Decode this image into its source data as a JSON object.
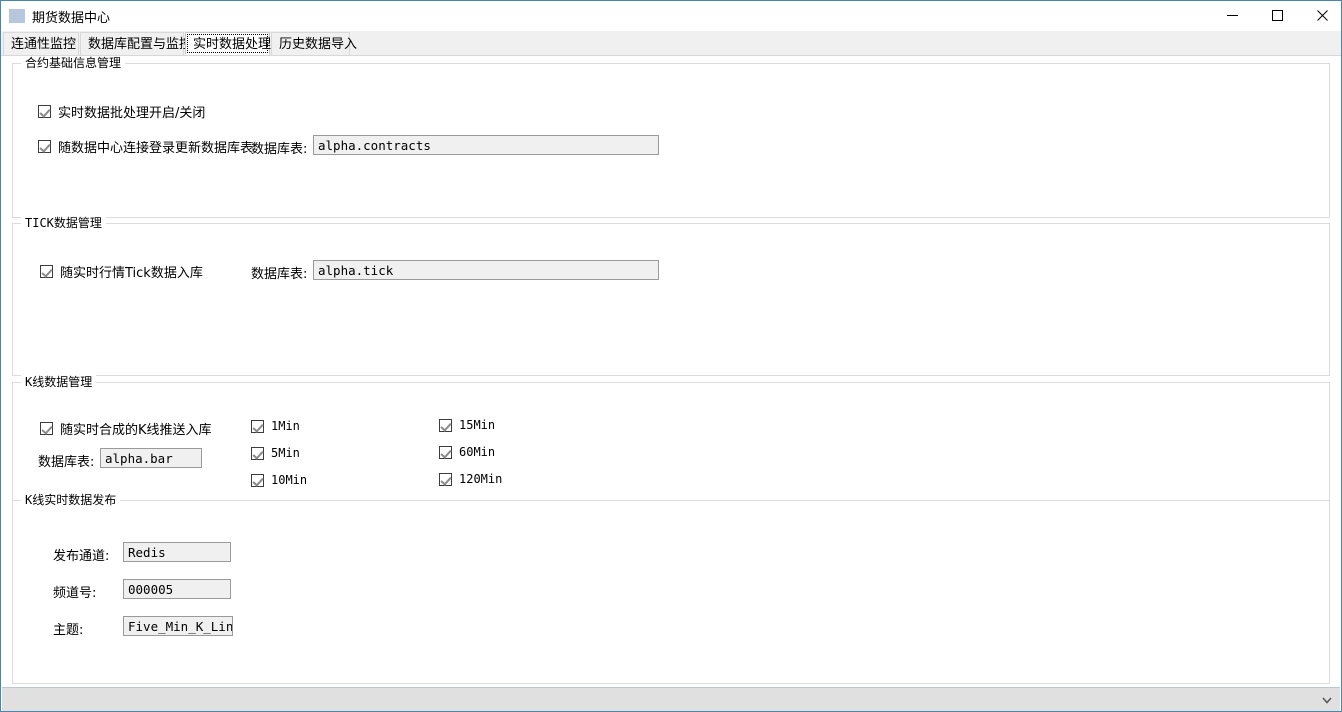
{
  "window": {
    "title": "期货数据中心",
    "icon": "app-icon",
    "controls": {
      "minimize": "minimize-icon",
      "maximize": "maximize-icon",
      "close": "close-icon"
    }
  },
  "tabs": [
    {
      "label": "连通性监控",
      "active": false
    },
    {
      "label": "数据库配置与监控",
      "active": false
    },
    {
      "label": "实时数据处理",
      "active": true
    },
    {
      "label": "历史数据导入",
      "active": false
    }
  ],
  "groups": {
    "contract": {
      "title": "合约基础信息管理",
      "checkboxes": [
        {
          "label": "实时数据批处理开启/关闭",
          "checked": true
        },
        {
          "label": "随数据中心连接登录更新数据库表",
          "checked": true
        }
      ],
      "db_label": "数据库表:",
      "db_value": "alpha.contracts"
    },
    "tick": {
      "title": "TICK数据管理",
      "checkboxes": [
        {
          "label": "随实时行情Tick数据入库",
          "checked": true
        }
      ],
      "db_label": "数据库表:",
      "db_value": "alpha.tick"
    },
    "kline": {
      "title": "K线数据管理",
      "checkbox_main": {
        "label": "随实时合成的K线推送入库",
        "checked": true
      },
      "db_label": "数据库表:",
      "db_value": "alpha.bar",
      "intervals_col1": [
        {
          "label": "1Min",
          "checked": true
        },
        {
          "label": "5Min",
          "checked": true
        },
        {
          "label": "10Min",
          "checked": true
        }
      ],
      "intervals_col2": [
        {
          "label": "15Min",
          "checked": true
        },
        {
          "label": "60Min",
          "checked": true
        },
        {
          "label": "120Min",
          "checked": true
        }
      ]
    },
    "publish": {
      "title": "K线实时数据发布",
      "fields": [
        {
          "label": "发布通道:",
          "value": "Redis"
        },
        {
          "label": "频道号:",
          "value": "000005"
        },
        {
          "label": "主题:",
          "value": "Five_Min_K_Line"
        }
      ]
    }
  },
  "scrollbar": {
    "chevron": "chevron-down-icon"
  }
}
